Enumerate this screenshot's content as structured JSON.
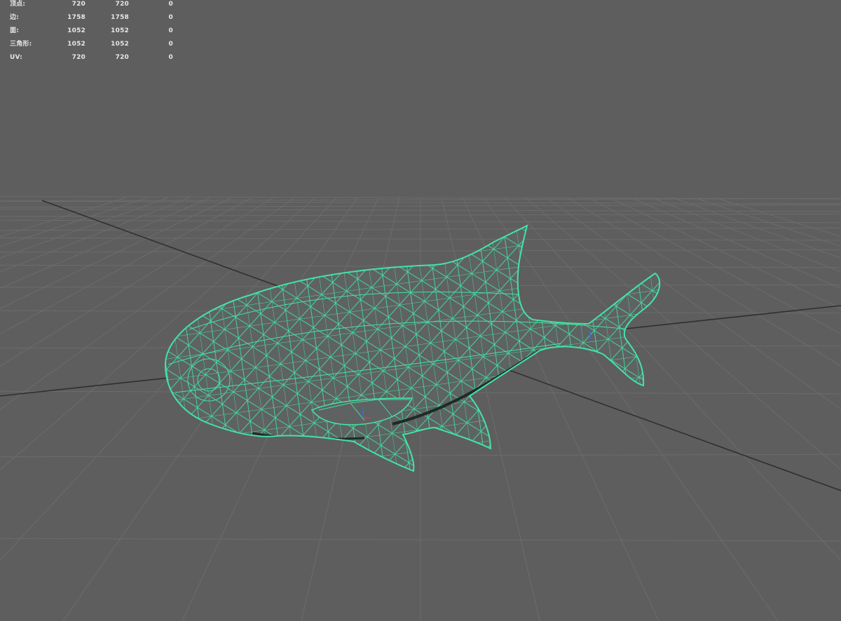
{
  "poly_count": {
    "rows": [
      {
        "label": "顶点:",
        "values": [
          "720",
          "720",
          "0"
        ]
      },
      {
        "label": "边:",
        "values": [
          "1758",
          "1758",
          "0"
        ]
      },
      {
        "label": "面:",
        "values": [
          "1052",
          "1052",
          "0"
        ]
      },
      {
        "label": "三角形:",
        "values": [
          "1052",
          "1052",
          "0"
        ]
      },
      {
        "label": "UV:",
        "values": [
          "720",
          "720",
          "0"
        ]
      }
    ]
  },
  "colors": {
    "background": "#5e5e5e",
    "grid_line": "#6c6c6c",
    "grid_axis": "#2f2f2f",
    "wireframe": "#43e3a6",
    "mesh_fill": "#5f6262"
  },
  "scene": {
    "object": "fish",
    "display_mode": "wireframe-on-shaded",
    "selected": true
  }
}
